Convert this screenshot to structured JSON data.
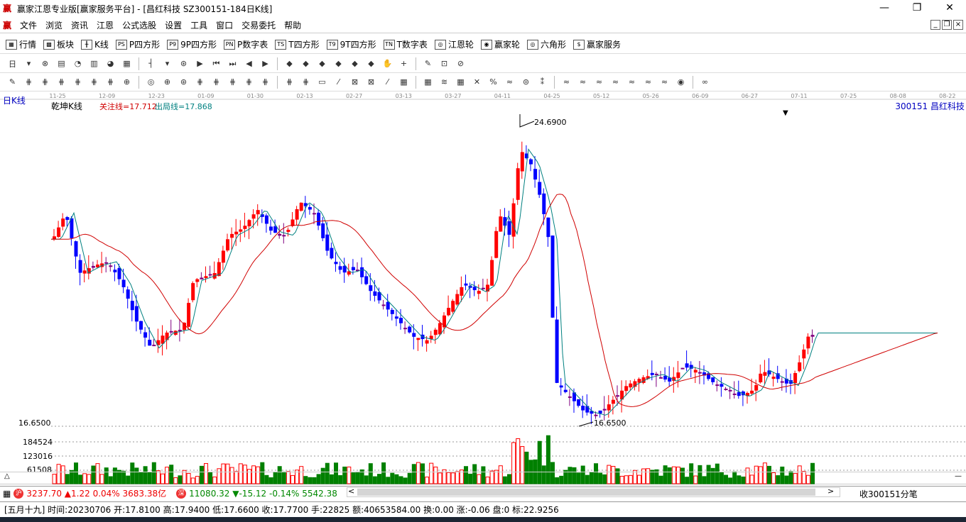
{
  "window": {
    "title": "赢家江恩专业版[赢家服务平台] - [昌红科技  SZ300151-184日K线]",
    "logo": "赢",
    "controls": [
      "—",
      "❐",
      "✕"
    ]
  },
  "menu": [
    "文件",
    "浏览",
    "资讯",
    "江恩",
    "公式选股",
    "设置",
    "工具",
    "窗口",
    "交易委托",
    "帮助"
  ],
  "mdi_controls": [
    "_",
    "❐",
    "×"
  ],
  "toolbar1": [
    {
      "icon": "grid-icon",
      "glyph": "▦",
      "label": "行情"
    },
    {
      "icon": "blocks-icon",
      "glyph": "▩",
      "label": "板块"
    },
    {
      "icon": "kline-icon",
      "glyph": "╫",
      "label": "K线"
    },
    {
      "icon": "ps-icon",
      "glyph": "PS",
      "label": "P四方形"
    },
    {
      "icon": "p9-icon",
      "glyph": "P9",
      "label": "9P四方形"
    },
    {
      "icon": "pn-icon",
      "glyph": "PN",
      "label": "P数字表"
    },
    {
      "icon": "ts-icon",
      "glyph": "TS",
      "label": "T四方形"
    },
    {
      "icon": "t9-icon",
      "glyph": "T9",
      "label": "9T四方形"
    },
    {
      "icon": "tn-icon",
      "glyph": "TN",
      "label": "T数字表"
    },
    {
      "icon": "wheel-icon",
      "glyph": "◎",
      "label": "江恩轮"
    },
    {
      "icon": "wheel2-icon",
      "glyph": "◉",
      "label": "赢家轮"
    },
    {
      "icon": "hexagon-icon",
      "glyph": "◎",
      "label": "六角形"
    },
    {
      "icon": "dollar-icon",
      "glyph": "$",
      "label": "赢家服务"
    }
  ],
  "chart": {
    "period_label": "日K线",
    "indicator_name": "乾坤K线",
    "watch_line": "关注线=17.712",
    "exit_line": "出局线=17.868",
    "stock_tag": "300151  昌红科技",
    "high_label": "24.6900",
    "low_label": "16.6500",
    "price_axis_label": "16.6500",
    "volume_labels": [
      "184524",
      "123016",
      "61508"
    ],
    "date_ticks": [
      "11-25",
      "12-09",
      "12-23",
      "01-09",
      "01-30",
      "02-13",
      "02-27",
      "03-13",
      "03-27",
      "04-11",
      "04-25",
      "05-12",
      "05-26",
      "06-09",
      "06-27",
      "07-11",
      "07-25",
      "08-08",
      "08-22"
    ]
  },
  "chart_data": {
    "type": "candlestick",
    "title": "",
    "y_range": [
      16.65,
      24.69
    ],
    "high": 24.69,
    "low": 16.65,
    "last_close": 17.77,
    "watch_line": 17.712,
    "exit_line": 17.868
  },
  "status_index": {
    "sh_value": "3237.70",
    "sh_change": "▲1.22",
    "sh_pct": "0.04%",
    "sh_amount": "3683.38亿",
    "sz_value": "11080.32",
    "sz_change": "▼-15.12",
    "sz_pct": "-0.14%",
    "sz_amount": "5542.38",
    "collect_label": "收300151分笔"
  },
  "status_bar": {
    "text": "[五月十九] 时间:20230706 开:17.8100 高:17.9400 低:17.6600 收:17.7700 手:22825 额:40653584.00 换:0.00 涨:-0.06 盘:0 标:22.9256"
  },
  "colors": {
    "up": "#ff0000",
    "down": "#0000ff",
    "neutral": "#800080",
    "volume": "#008000",
    "ma_red": "#d00000",
    "ma_teal": "#008080"
  }
}
